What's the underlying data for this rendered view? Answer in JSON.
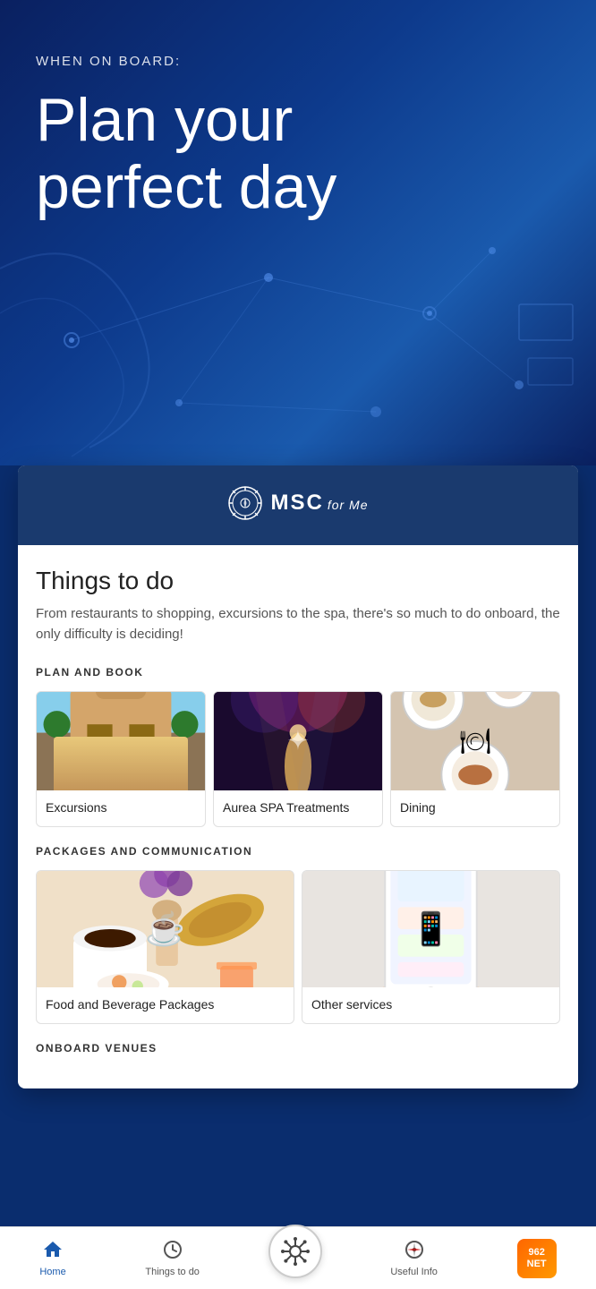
{
  "hero": {
    "label": "WHEN ON BOARD:",
    "title_line1": "Plan your",
    "title_line2": "perfect day"
  },
  "logo": {
    "brand": "MSC",
    "tagline": "for Me"
  },
  "things_to_do": {
    "heading": "Things to do",
    "description": "From restaurants to shopping, excursions to the spa, there's so much to do onboard, the only difficulty is deciding!"
  },
  "plan_and_book": {
    "label": "PLAN AND BOOK",
    "items": [
      {
        "id": "excursions",
        "label": "Excursions"
      },
      {
        "id": "spa",
        "label": "Aurea SPA Treatments"
      },
      {
        "id": "dining",
        "label": "Dining"
      }
    ]
  },
  "packages": {
    "label": "PACKAGES AND COMMUNICATION",
    "items": [
      {
        "id": "food-pkg",
        "label": "Food and Beverage Packages"
      },
      {
        "id": "other",
        "label": "Other services"
      }
    ]
  },
  "onboard": {
    "label": "ONBOARD VENUES"
  },
  "nav": {
    "items": [
      {
        "id": "home",
        "label": "Home",
        "icon": "⌂"
      },
      {
        "id": "things-to-do",
        "label": "Things to do",
        "icon": "🕐"
      },
      {
        "id": "wheel",
        "label": "",
        "icon": "⚙"
      },
      {
        "id": "useful-info",
        "label": "Useful Info",
        "icon": "◎"
      },
      {
        "id": "watermark",
        "label": "",
        "icon": ""
      }
    ],
    "home_label": "Home",
    "things_label": "Things to do",
    "useful_label": "Useful Info"
  }
}
